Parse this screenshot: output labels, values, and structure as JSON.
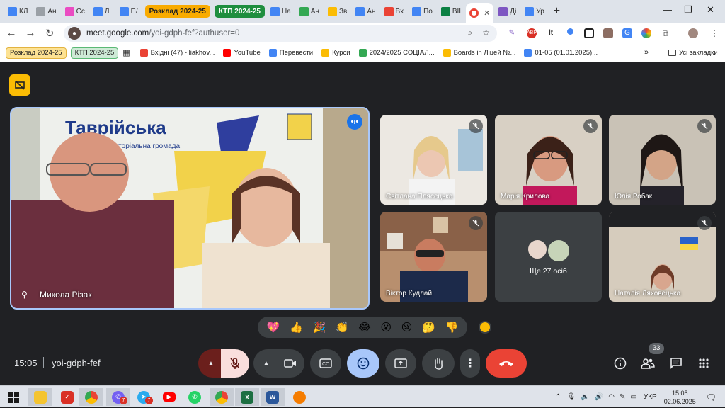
{
  "browser": {
    "tabs": [
      {
        "label": "КЛ",
        "color": "#4285f4"
      },
      {
        "label": "Ан",
        "color": "#9aa0a6"
      },
      {
        "label": "Сс",
        "color": "#ea4cc2"
      },
      {
        "label": "Лі",
        "color": "#4285f4"
      },
      {
        "label": "П/",
        "color": "#4285f4"
      }
    ],
    "tab_group_1": {
      "label": "Розклад 2024-25",
      "color": "#f9ab00"
    },
    "tab_group_2": {
      "label": "КТП 2024-25",
      "color": "#1e8e3e"
    },
    "tabs_after": [
      {
        "label": "На",
        "color": "#4285f4"
      },
      {
        "label": "Ан",
        "color": "#34a853"
      },
      {
        "label": "Зв",
        "color": "#fbbc04"
      },
      {
        "label": "Ан",
        "color": "#4285f4"
      },
      {
        "label": "Вх",
        "color": "#ea4335"
      },
      {
        "label": "По",
        "color": "#4285f4"
      },
      {
        "label": "ВІІ",
        "color": "#0b8043"
      }
    ],
    "active_tab": {
      "label": "",
      "color": "#ea4335"
    },
    "tabs_end": [
      {
        "label": "Ді",
        "color": "#7e57c2"
      },
      {
        "label": "Ур",
        "color": "#4285f4"
      }
    ],
    "new_tab": "+",
    "url_host": "meet.google.com",
    "url_path": "/yoi-gdph-fef?authuser=0",
    "bookmarks_groups": [
      {
        "label": "Розклад 2024-25",
        "color": "#fde293"
      },
      {
        "label": "КТП 2024-25",
        "color": "#ceead6"
      }
    ],
    "bookmarks": [
      {
        "label": "Вхідні (47) - liakhov...",
        "color": "#ea4335"
      },
      {
        "label": "YouTube",
        "color": "#ff0000"
      },
      {
        "label": "Перевести",
        "color": "#4285f4"
      },
      {
        "label": "Курси",
        "color": "#fbbc04"
      },
      {
        "label": "2024/2025 СОЦІАЛ...",
        "color": "#34a853"
      },
      {
        "label": "Boards in Ліцей №...",
        "color": "#fbbc04"
      },
      {
        "label": "01-05 (01.01.2025)...",
        "color": "#4285f4"
      }
    ],
    "all_bookmarks": "Усі закладки"
  },
  "meet": {
    "main_participant": "Микола Різак",
    "participants": [
      {
        "name": "Світлана Плясецька"
      },
      {
        "name": "Марія Крилова"
      },
      {
        "name": "Юлія Робак"
      },
      {
        "name": "Віктор Кудлай"
      },
      {
        "name": "Наталія Ляховецька"
      }
    ],
    "others_label": "Ще 27 осіб",
    "reactions": [
      "💖",
      "👍",
      "🎉",
      "👏",
      "😂",
      "😮",
      "😢",
      "🤔",
      "👎"
    ],
    "time": "15:05",
    "meeting_code": "yoi-gdph-fef",
    "people_count": "33",
    "colors": {
      "end_call": "#ea4335",
      "mic_off": "#f9dedc",
      "emoji_active": "#a8c7fa"
    }
  },
  "taskbar": {
    "telegram_badge": "7",
    "viber_badge": "7",
    "lang": "УКР",
    "clock_time": "15:05",
    "clock_date": "02.06.2025"
  }
}
